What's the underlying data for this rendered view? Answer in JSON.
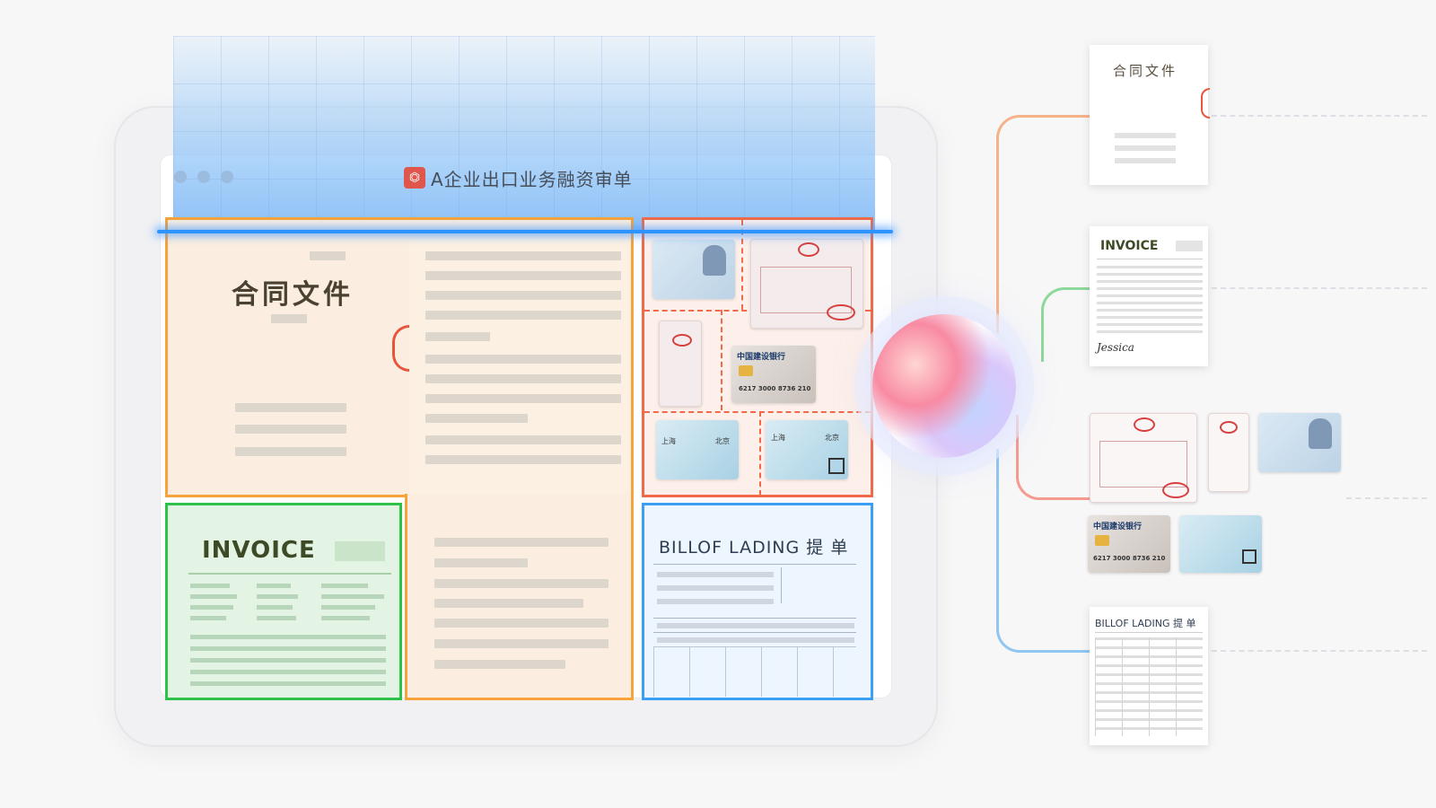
{
  "window": {
    "title": "A企业出口业务融资审单"
  },
  "regions": {
    "contract": {
      "title": "合同文件"
    },
    "invoice": {
      "title": "INVOICE"
    },
    "bill_of_lading": {
      "title": "BILLOF LADING 提 单"
    },
    "id_docs": {
      "bank_name": "中国建设银行",
      "bank_card_number": "6217 3000 8736 210",
      "ticket_from": "上海",
      "ticket_to": "北京"
    }
  },
  "outputs": {
    "contract": {
      "title": "合同文件"
    },
    "invoice": {
      "title": "INVOICE",
      "signature": "Jessica"
    },
    "id_docs": {
      "bank_name": "中国建设银行",
      "bank_card_number": "6217 3000 8736 210"
    },
    "bill_of_lading": {
      "title": "BILLOF LADING 提 单"
    }
  },
  "colors": {
    "contract": "#f7a33b",
    "id_docs": "#f06a4a",
    "invoice": "#2fc24b",
    "bill_of_lading": "#3ba0f5",
    "scan_line": "#2d94ff"
  },
  "icons": [
    "pdf-icon",
    "ai-orb-icon",
    "stamp-icon",
    "chip-icon",
    "qr-icon"
  ]
}
